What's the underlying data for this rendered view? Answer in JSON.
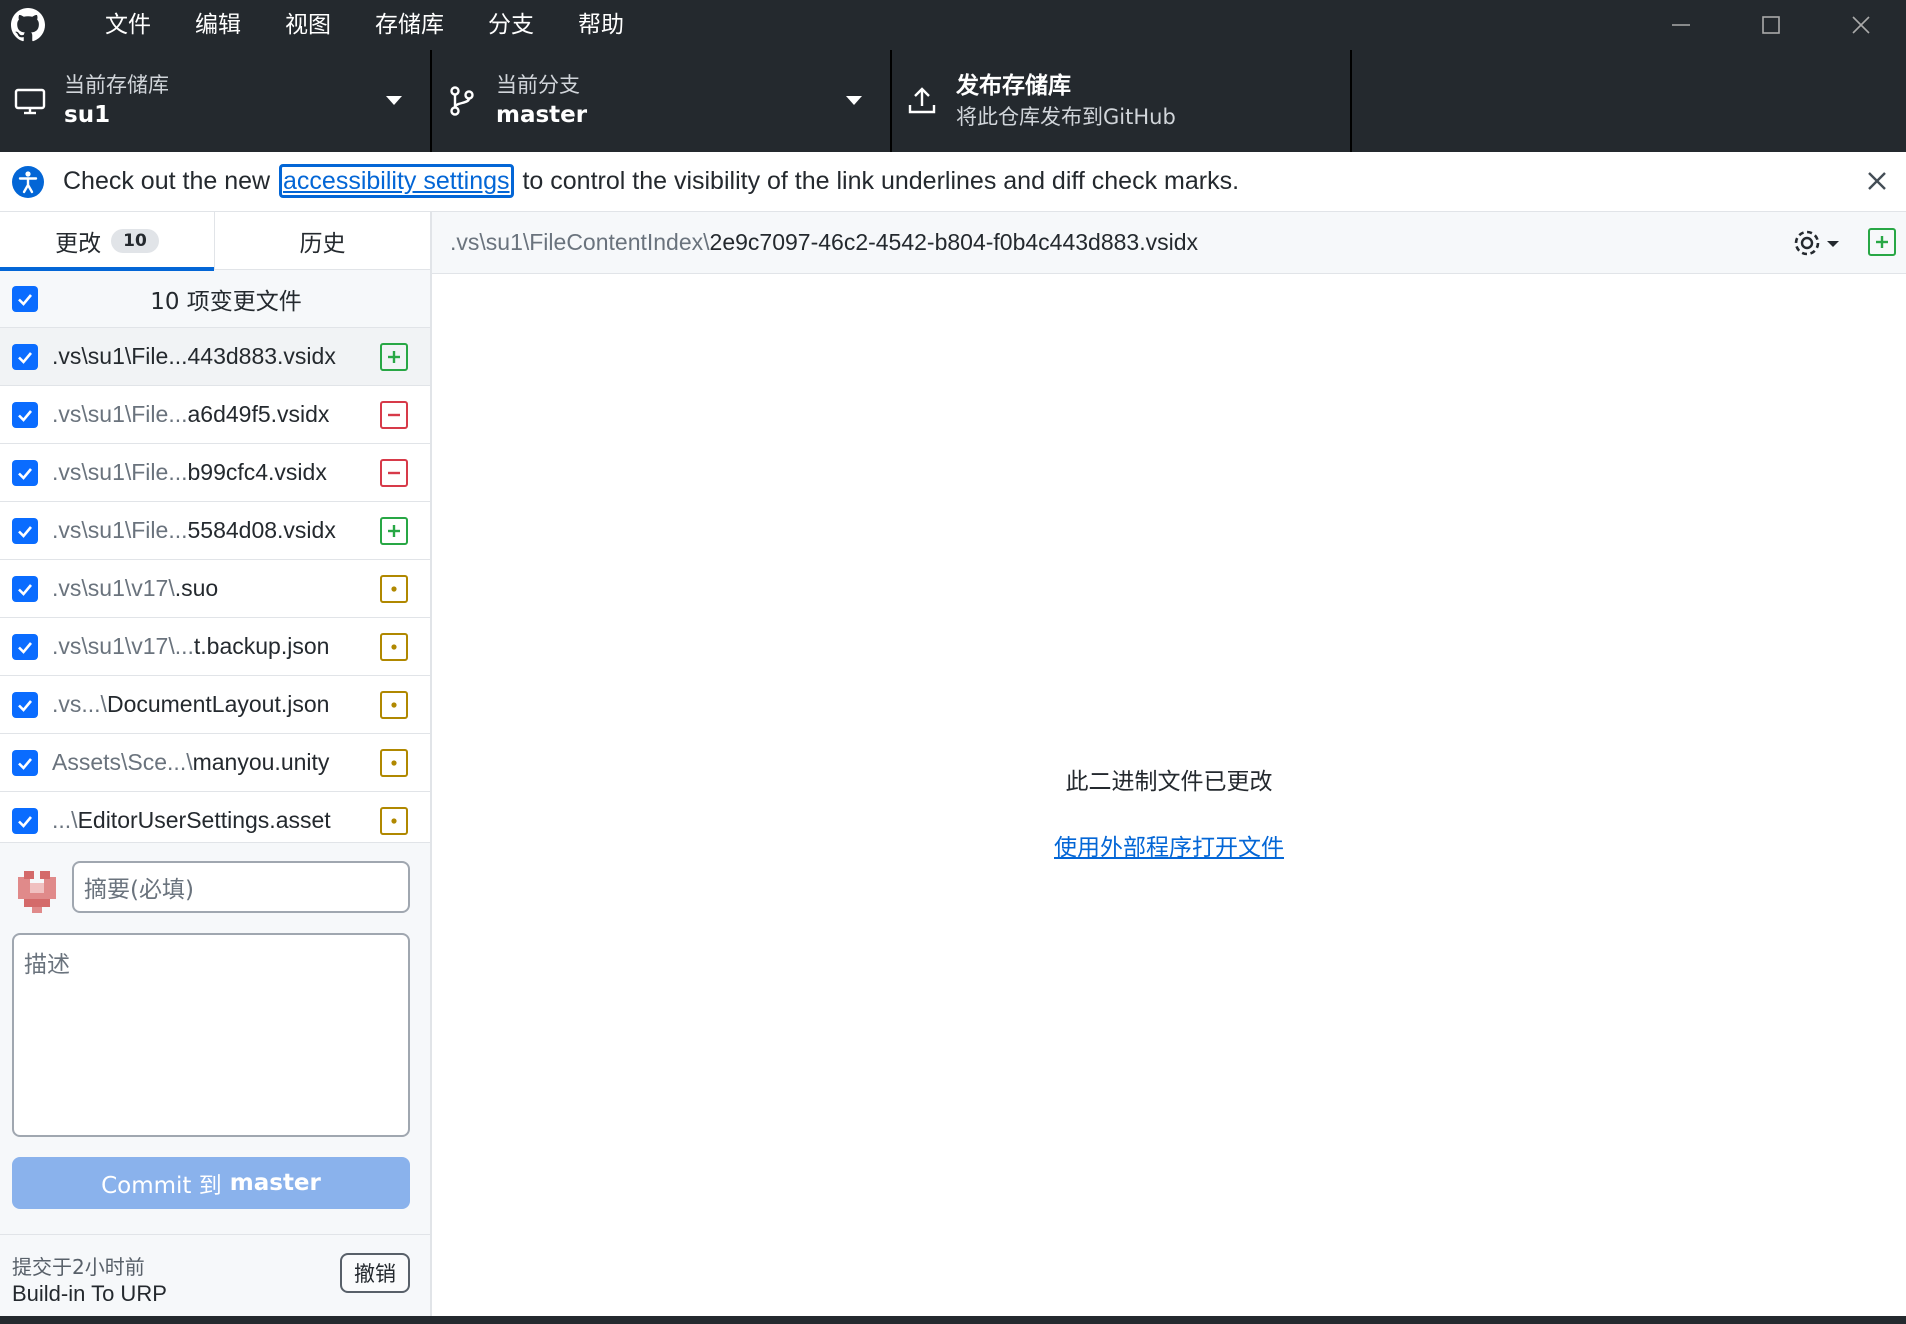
{
  "menu": [
    "文件",
    "编辑",
    "视图",
    "存储库",
    "分支",
    "帮助"
  ],
  "toolbar": {
    "repo_label": "当前存储库",
    "repo_value": "su1",
    "branch_label": "当前分支",
    "branch_value": "master",
    "publish_title": "发布存储库",
    "publish_sub": "将此仓库发布到GitHub"
  },
  "banner": {
    "prefix": "Check out the new",
    "link": "accessibility settings",
    "suffix": "to control the visibility of the link underlines and diff check marks."
  },
  "tabs": {
    "changes": "更改",
    "changes_count": "10",
    "history": "历史"
  },
  "select_all_label": "10 项变更文件",
  "files": [
    {
      "dim": ".vs\\su1\\File...",
      "main": "443d883.vsidx",
      "status": "added"
    },
    {
      "dim": ".vs\\su1\\File...",
      "main": "a6d49f5.vsidx",
      "status": "deleted"
    },
    {
      "dim": ".vs\\su1\\File...",
      "main": "b99cfc4.vsidx",
      "status": "deleted"
    },
    {
      "dim": ".vs\\su1\\File...",
      "main": "5584d08.vsidx",
      "status": "added"
    },
    {
      "dim": ".vs\\su1\\v17\\",
      "main": ".suo",
      "status": "modified"
    },
    {
      "dim": ".vs\\su1\\v17\\...",
      "main": "t.backup.json",
      "status": "modified"
    },
    {
      "dim": ".vs...\\",
      "main": "DocumentLayout.json",
      "status": "modified"
    },
    {
      "dim": "Assets\\Sce...\\",
      "main": "manyou.unity",
      "status": "modified"
    },
    {
      "dim": "...\\",
      "main": "EditorUserSettings.asset",
      "status": "modified"
    }
  ],
  "commit": {
    "summary_placeholder": "摘要(必填)",
    "description_placeholder": "描述",
    "button_prefix": "Commit 到",
    "button_branch": "master"
  },
  "last_commit": {
    "time": "提交于2小时前",
    "title": "Build-in To URP",
    "undo": "撤销"
  },
  "diff": {
    "path_dim": ".vs\\su1\\FileContentIndex\\",
    "path_main": "2e9c7097-46c2-4542-b804-f0b4c443d883.vsidx",
    "binary_message": "此二进制文件已更改",
    "open_external": "使用外部程序打开文件"
  },
  "colors": {
    "titlebar_bg": "#24292e",
    "accent": "#0366d6",
    "added": "#28a745",
    "deleted": "#d73a49",
    "modified": "#b08800",
    "commit_button": "#8ab2ec"
  }
}
